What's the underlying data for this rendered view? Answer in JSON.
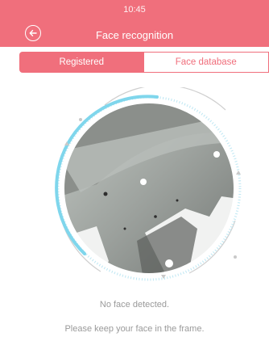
{
  "status_bar": {
    "time": "10:45"
  },
  "header": {
    "title": "Face recognition"
  },
  "tabs": [
    {
      "label": "Registered",
      "active": true
    },
    {
      "label": "Face database",
      "active": false
    }
  ],
  "messages": {
    "status": "No face detected.",
    "instruction": "Please keep your face in the frame."
  },
  "colors": {
    "accent": "#f06f7c",
    "scan_ring": "#7fd6ec",
    "muted_text": "#9a9a9a"
  },
  "icons": {
    "back": "back-arrow-circle-icon"
  }
}
